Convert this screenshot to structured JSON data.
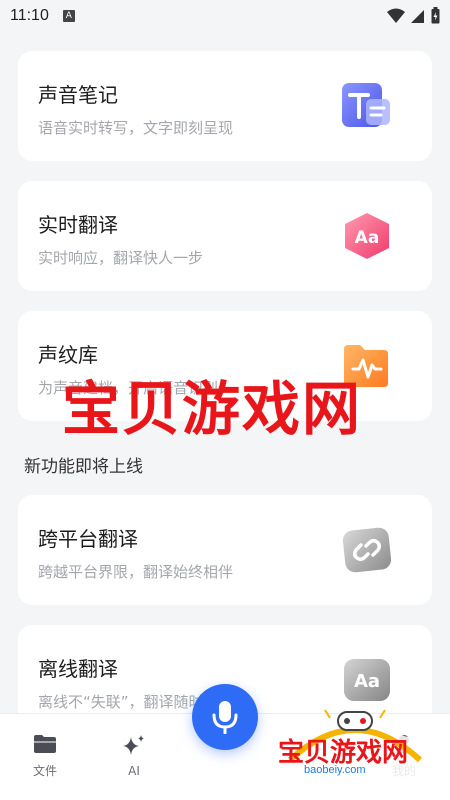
{
  "status_bar": {
    "time": "11:10",
    "notification_glyph": "A"
  },
  "cards": [
    {
      "title": "声音笔记",
      "subtitle": "语音实时转写，文字即刻呈现",
      "icon": "text-note-icon"
    },
    {
      "title": "实时翻译",
      "subtitle": "实时响应，翻译快人一步",
      "icon": "aa-translate-icon"
    },
    {
      "title": "声纹库",
      "subtitle": "为声音建档，开启语音识别",
      "icon": "voiceprint-folder-icon"
    },
    {
      "title": "跨平台翻译",
      "subtitle": "跨越平台界限，翻译始终相伴",
      "icon": "link-icon"
    },
    {
      "title": "离线翻译",
      "subtitle": "离线不“失联”，翻译随时分享",
      "icon": "offline-aa-icon"
    }
  ],
  "section": {
    "coming_soon": "新功能即将上线"
  },
  "watermark": {
    "text": "宝贝游戏网",
    "logo_text": "宝贝游戏网",
    "url": "baobeiy.com"
  },
  "bottom_nav": {
    "items": [
      {
        "label": "文件",
        "icon": "folder-icon"
      },
      {
        "label": "AI",
        "icon": "sparkle-icon"
      },
      {
        "label": "我的",
        "icon": "profile-icon"
      }
    ],
    "mic_icon": "microphone-icon"
  },
  "colors": {
    "accent": "#2f6cf6",
    "background": "#f4f5f7",
    "watermark": "#e8161b"
  }
}
